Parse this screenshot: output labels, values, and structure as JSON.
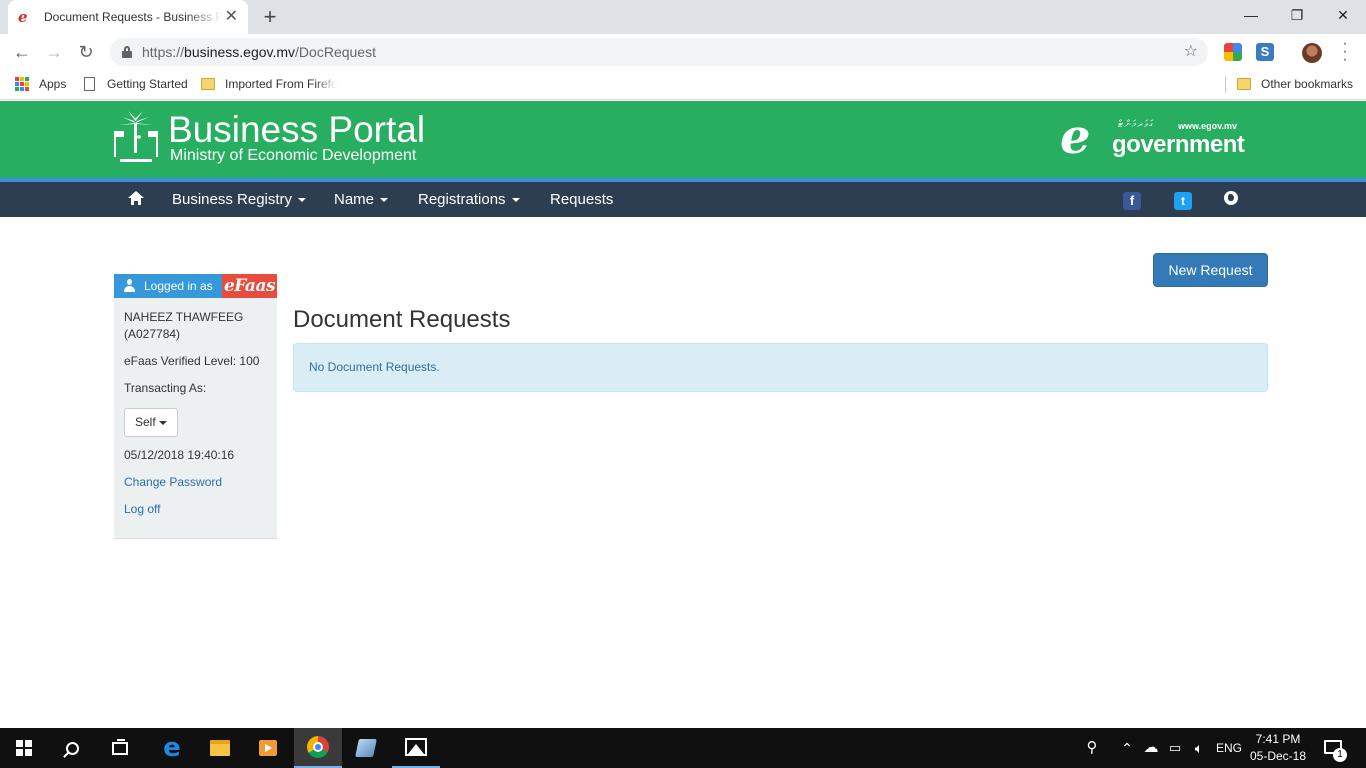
{
  "browser": {
    "tab_title": "Document Requests - Business Portal",
    "tab_close": "✕",
    "new_tab": "+",
    "window_controls": {
      "minimize": "—",
      "restore": "❐",
      "close": "✕"
    },
    "url_prefix": "https://",
    "url_host": "business.egov.mv",
    "url_path": "/DocRequest",
    "bookmarks": [
      {
        "label": "Apps",
        "icon": "apps-grid-icon"
      },
      {
        "label": "Getting Started",
        "icon": "page-icon"
      },
      {
        "label": "Imported From Firefox",
        "icon": "folder-icon"
      }
    ],
    "other_bookmarks": "Other bookmarks"
  },
  "header": {
    "title": "Business Portal",
    "subtitle": "Ministry of Economic Development",
    "egov_url": "www.egov.mv",
    "egov_word": "government",
    "egov_script": "ގަވަރމަންޓް",
    "egov_letter": "e",
    "brand_color": "#27ae60"
  },
  "nav": {
    "items": [
      {
        "label": "Business Registry",
        "dropdown": true
      },
      {
        "label": "Name",
        "dropdown": true
      },
      {
        "label": "Registrations",
        "dropdown": true
      },
      {
        "label": "Requests",
        "dropdown": false
      }
    ],
    "facebook": "f",
    "twitter": "t"
  },
  "sidebar": {
    "logged_in_as": "Logged in as",
    "efaas_logo": "eFaas",
    "user_name": "NAHEEZ THAWFEEG",
    "user_id": "(A027784)",
    "verified_level": "eFaas Verified Level: 100",
    "transacting_as_label": "Transacting As:",
    "transacting_as_value": "Self",
    "timestamp": "05/12/2018 19:40:16",
    "change_password": "Change Password",
    "log_off": "Log off"
  },
  "main": {
    "new_request_label": "New Request",
    "page_title": "Document Requests",
    "empty_message": "No Document Requests."
  },
  "taskbar": {
    "language": "ENG",
    "time": "7:41 PM",
    "date": "05-Dec-18",
    "notification_count": "1"
  }
}
